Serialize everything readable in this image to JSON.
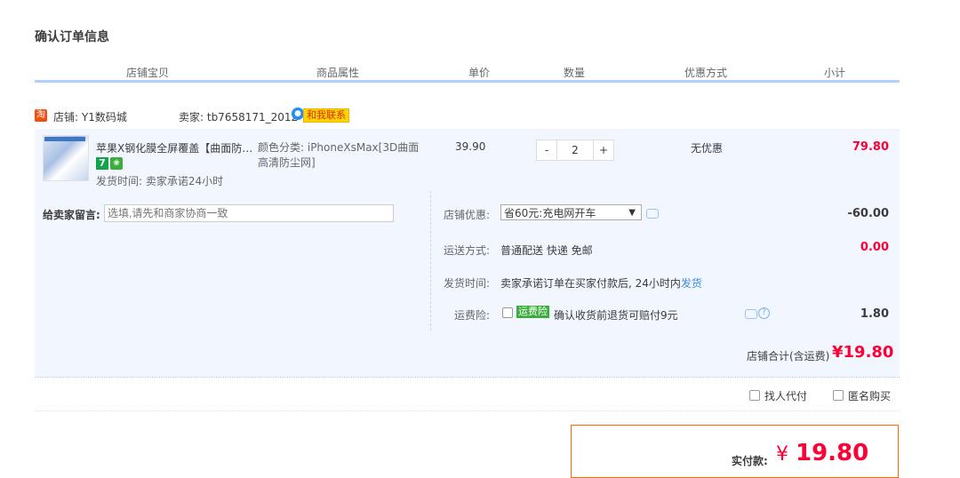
{
  "page": {
    "title": "确认订单信息"
  },
  "columns": [
    "店铺宝贝",
    "商品属性",
    "单价",
    "数量",
    "优惠方式",
    "小计"
  ],
  "shop": {
    "logo_text": "淘",
    "name": "店铺: Y1数码城",
    "seller": "卖家: tb7658171_2012",
    "contact_label": "和我联系"
  },
  "item": {
    "title": "苹果X钢化膜全屏覆盖【曲面防尘网】",
    "badge_7": "7",
    "badge_icon": "leaf-icon",
    "ship_time": "发货时间: 卖家承诺24小时",
    "attr": "颜色分类: iPhoneXsMax[3D曲面高清防尘网]",
    "price": "39.90",
    "qty_minus": "-",
    "qty": "2",
    "qty_plus": "+",
    "promo": "无优惠",
    "subtotal": "79.80"
  },
  "options": {
    "msg_label": "给卖家留言:",
    "msg_placeholder": "选填,请先和商家协商一致",
    "shop_promo_label": "店铺优惠:",
    "shop_promo_value": "省60元:充电网开车",
    "shop_promo_amount": "-60.00",
    "delivery_label": "运送方式:",
    "delivery_value": "普通配送 快递 免邮",
    "delivery_amount": "0.00",
    "ship_time_label": "发货时间:",
    "ship_time_value": "卖家承诺订单在买家付款后, 24小时内",
    "ship_time_link": "发货",
    "insurance_label": "运费险:",
    "insurance_badge": "运费险",
    "insurance_text": "确认收货前退货可赔付9元",
    "insurance_amount": "1.80"
  },
  "shop_total": {
    "label": "店铺合计(含运费)",
    "amount": "¥19.80"
  },
  "extras": {
    "pay_for_me": "找人代付",
    "anonymous": "匿名购买"
  },
  "payment": {
    "label": "实付款:",
    "currency": "¥",
    "amount": "19.80"
  },
  "colors": {
    "accent_red": "#ff0036",
    "header_blue": "#b2d1ff",
    "bg_blue": "#f2f7ff",
    "orange": "#ff6a00"
  }
}
